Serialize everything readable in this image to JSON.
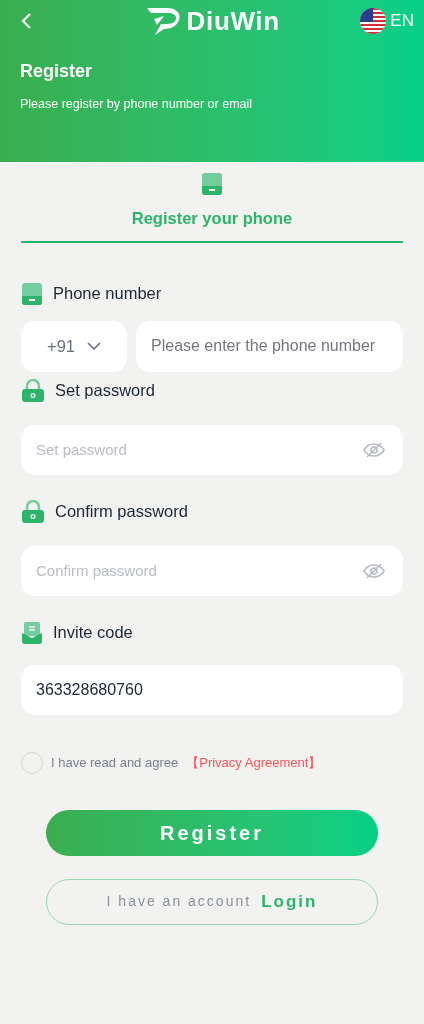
{
  "header": {
    "logo": "DiuWin",
    "language": "EN",
    "title": "Register",
    "subtitle": "Please register by phone number or email"
  },
  "tabs": [
    {
      "label": "Register your phone",
      "selected": true
    }
  ],
  "fields": [
    {
      "kind": "phone",
      "label": "Phone number",
      "code": "+91",
      "placeholder": "Please enter the phone number"
    },
    {
      "kind": "password",
      "label": "Set password",
      "placeholder": "Set password"
    },
    {
      "kind": "password",
      "label": "Confirm password",
      "placeholder": "Confirm password"
    },
    {
      "kind": "text",
      "label": "Invite code",
      "value": "363328680760"
    }
  ],
  "agreement": {
    "checked": false,
    "text": "I have read and agree",
    "link": "【Privacy Agreement】"
  },
  "register_button": "Register",
  "login": {
    "text": "I have an account",
    "link": "Login"
  }
}
